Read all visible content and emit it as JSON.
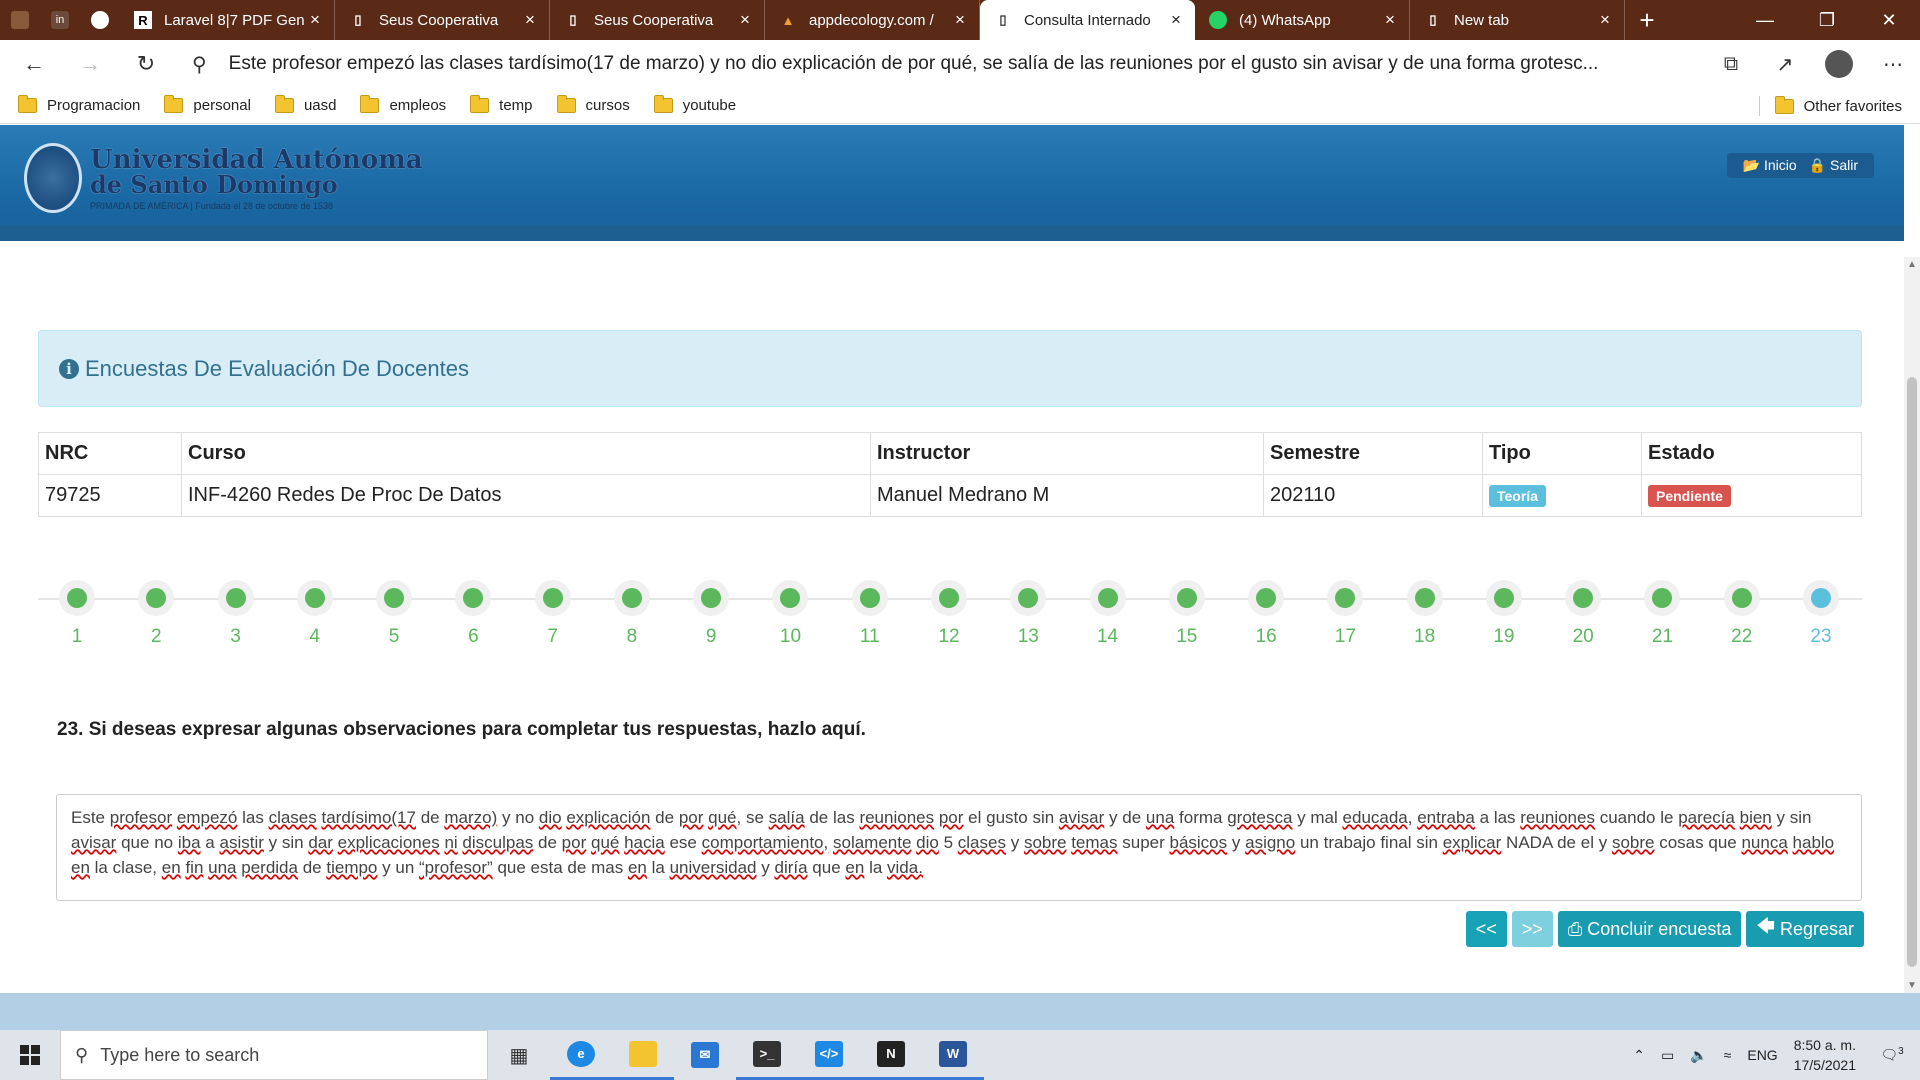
{
  "browser": {
    "tabs": [
      {
        "title": "Laravel 8|7 PDF Gen",
        "favicon": "R",
        "fav_color": "#000000",
        "active": false
      },
      {
        "title": "Seus Cooperativa",
        "favicon": "page-icon",
        "active": false
      },
      {
        "title": "Seus Cooperativa",
        "favicon": "page-icon",
        "active": false
      },
      {
        "title": "appdecology.com /",
        "favicon": "flame-icon",
        "active": false
      },
      {
        "title": "Consulta Internado",
        "favicon": "page-icon",
        "active": true
      },
      {
        "title": "(4) WhatsApp",
        "favicon": "whatsapp-icon",
        "active": false
      },
      {
        "title": "New tab",
        "favicon": "newtab-icon",
        "active": false
      }
    ],
    "address": "Este profesor empezó las clases tardísimo(17 de marzo) y no dio explicación de por qué, se salía de las reuniones por el gusto sin avisar y de una forma grotesc...",
    "bookmarks": [
      "Programacion",
      "personal",
      "uasd",
      "empleos",
      "temp",
      "cursos",
      "youtube"
    ],
    "other_favorites": "Other favorites"
  },
  "site": {
    "logo_line1": "Universidad Autónoma",
    "logo_line2": "de Santo Domingo",
    "logo_line3": "PRIMADA DE AMÉRICA  |  Fundada el 28 de octubre de 1538",
    "nav_inicio": "Inicio",
    "nav_salir": "Salir"
  },
  "survey": {
    "info_title": "Encuestas De Evaluación De Docentes",
    "columns": [
      "NRC",
      "Curso",
      "Instructor",
      "Semestre",
      "Tipo",
      "Estado"
    ],
    "row": {
      "nrc": "79725",
      "curso": "INF-4260 Redes De Proc De Datos",
      "instructor": "Manuel Medrano M",
      "semestre": "202110",
      "tipo": "Teoría",
      "estado": "Pendiente"
    },
    "tipo_color": "#5bc0de",
    "estado_color": "#d9534f",
    "steps": [
      "1",
      "2",
      "3",
      "4",
      "5",
      "6",
      "7",
      "8",
      "9",
      "10",
      "11",
      "12",
      "13",
      "14",
      "15",
      "16",
      "17",
      "18",
      "19",
      "20",
      "21",
      "22",
      "23"
    ],
    "current_step": "23",
    "question": "23. Si deseas expresar algunas observaciones para completar tus respuestas, hazlo aquí.",
    "answer": "Este profesor empezó las clases tardísimo(17 de marzo) y no dio explicación de por qué, se salía de las reuniones por el gusto sin avisar y de una forma grotesca y mal educada, entraba a las reuniones cuando le parecía bien y sin avisar que no iba a asistir y sin dar explicaciones ni disculpas de por qué hacia ese comportamiento, solamente dio 5 clases y sobre temas super básicos y asigno un trabajo final sin explicar NADA de el y sobre cosas que nunca hablo en la clase, en fin una perdida de tiempo y un “profesor” que esta de mas en la universidad y diría que en la vida.",
    "btn_prev": "<<",
    "btn_next": ">>",
    "btn_conclude": "Concluir encuesta",
    "btn_back": "Regresar"
  },
  "taskbar": {
    "search_placeholder": "Type here to search",
    "lang": "ENG",
    "time": "8:50 a. m.",
    "date": "17/5/2021",
    "notifications": "3"
  }
}
